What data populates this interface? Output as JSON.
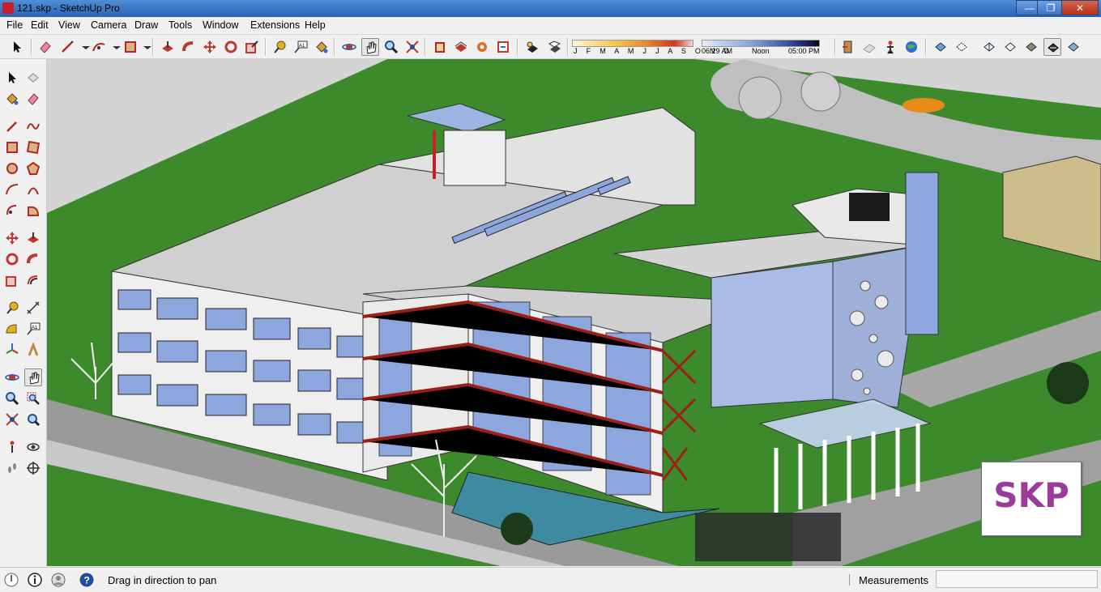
{
  "window": {
    "title": "121.skp - SketchUp Pro",
    "minimize": "—",
    "maximize": "❐",
    "close": "✕"
  },
  "menu": [
    "File",
    "Edit",
    "View",
    "Camera",
    "Draw",
    "Tools",
    "Window",
    "Extensions",
    "Help"
  ],
  "shadow": {
    "months": "J F M A M J J A S O N D",
    "time_start": "06:29 AM",
    "time_mid": "Noon",
    "time_end": "05:00 PM"
  },
  "viewport": {
    "badge": "SKP"
  },
  "status": {
    "hint": "Drag in direction to pan",
    "measurements_label": "Measurements",
    "measurements_value": ""
  },
  "colors": {
    "accent_red": "#c8202b",
    "glass_blue": "#9eb3e6",
    "grass": "#3e8a2c",
    "badge_purple": "#9b3b9a"
  }
}
